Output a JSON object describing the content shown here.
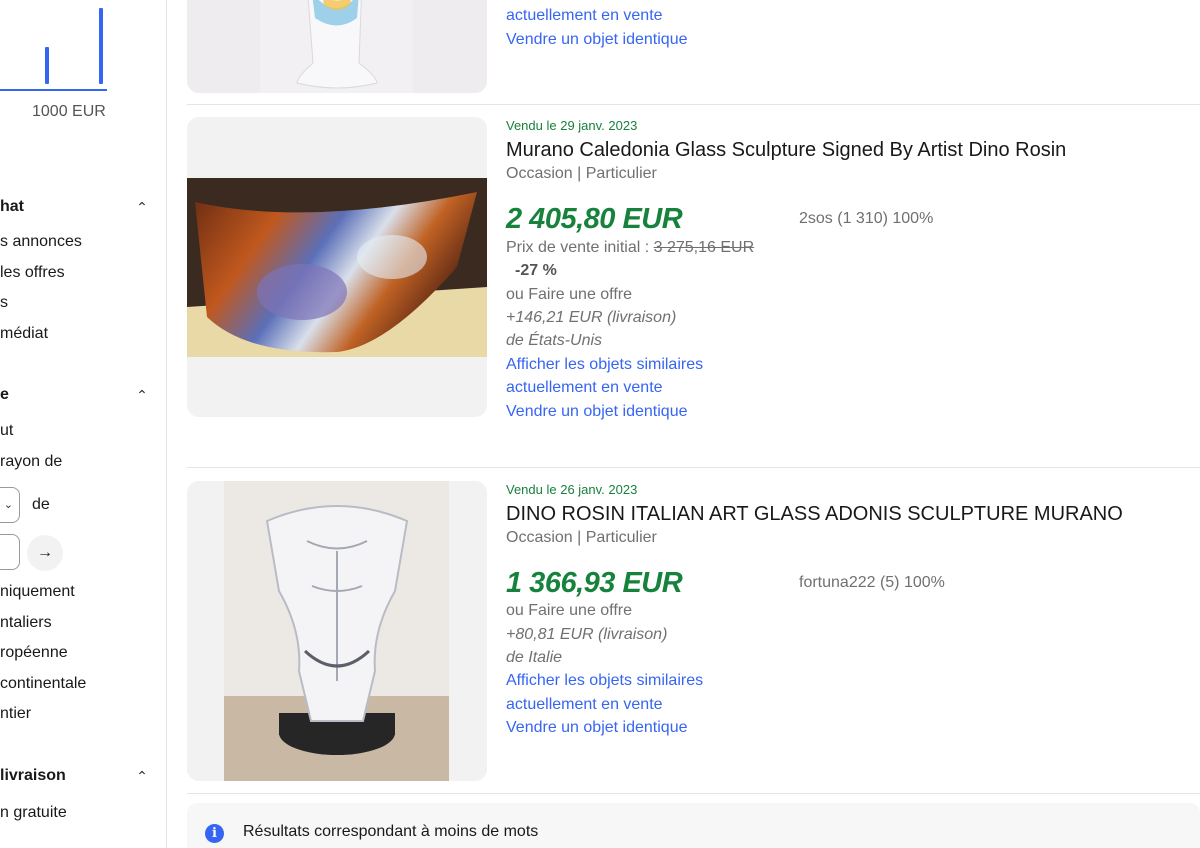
{
  "sidebar": {
    "price_max_label": "1000 EUR",
    "section_purchase": "hat",
    "purchase_options": [
      "s annonces",
      "les offres",
      "s",
      "médiat"
    ],
    "section_location": "e",
    "location_options": [
      "ut",
      " rayon de"
    ],
    "radius_suffix": "de",
    "location_more": [
      "niquement",
      "ntaliers",
      "ropéenne",
      "continentale",
      "ntier"
    ],
    "section_delivery": "livraison",
    "delivery_options": [
      "n gratuite"
    ]
  },
  "results": [
    {
      "links": [
        "actuellement en vente",
        "Vendre un objet identique"
      ]
    },
    {
      "sold_date": "Vendu le 29 janv. 2023",
      "title": "Murano Caledonia Glass Sculpture Signed By Artist Dino Rosin",
      "condition": "Occasion | Particulier",
      "price": "2 405,80 EUR",
      "initial_price_label": "Prix de vente initial : ",
      "initial_price": "3 275,16 EUR",
      "discount": "-27 %",
      "offer": "ou Faire une offre",
      "shipping": "+146,21 EUR (livraison)",
      "origin": "de États-Unis",
      "link_similar": "Afficher les objets similaires",
      "link_similar_2": "actuellement en vente",
      "link_sell": "Vendre un objet identique",
      "seller": "2sos (1 310) 100%"
    },
    {
      "sold_date": "Vendu le 26 janv. 2023",
      "title": "DINO ROSIN ITALIAN ART GLASS ADONIS SCULPTURE MURANO",
      "condition": "Occasion | Particulier",
      "price": "1 366,93 EUR",
      "offer": "ou Faire une offre",
      "shipping": "+80,81 EUR (livraison)",
      "origin": "de Italie",
      "link_similar": "Afficher les objets similaires",
      "link_similar_2": "actuellement en vente",
      "link_sell": "Vendre un objet identique",
      "seller": "fortuna222 (5) 100%"
    }
  ],
  "notice": {
    "icon": "info-icon",
    "text": "Résultats correspondant à moins de mots"
  },
  "colors": {
    "accent_blue": "#3665f3",
    "sold_green": "#17823b"
  }
}
